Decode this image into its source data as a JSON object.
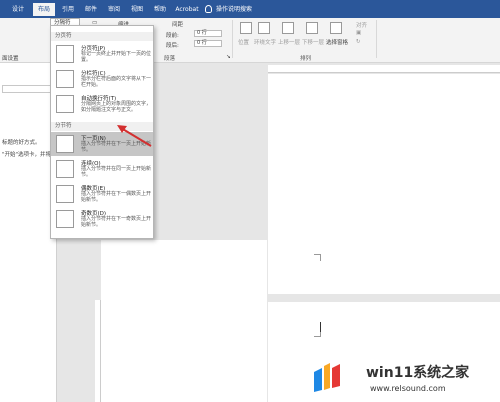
{
  "tabs": [
    {
      "label": "设计",
      "active": false
    },
    {
      "label": "布局",
      "active": true
    },
    {
      "label": "引用",
      "active": false
    },
    {
      "label": "邮件",
      "active": false
    },
    {
      "label": "审阅",
      "active": false
    },
    {
      "label": "视图",
      "active": false
    },
    {
      "label": "帮助",
      "active": false
    },
    {
      "label": "Acrobat",
      "active": false
    }
  ],
  "tell_me": "操作说明搜索",
  "ribbon": {
    "breaks_btn": "分隔符",
    "indent_label": "缩进",
    "spacing_label": "间距",
    "spacing_before": "段前:",
    "spacing_after": "段后:",
    "spacing_before_val": "0 行",
    "spacing_after_val": "0 行",
    "paragraph_group": "段落",
    "page_setup_group": "页面设置",
    "position_btn": "位置",
    "wrap_btn": "环绕文字",
    "forward_btn": "上移一层",
    "backward_btn": "下移一层",
    "selection_pane_btn": "选择窗格",
    "align_btn": "对齐",
    "arrange_group": "排列"
  },
  "leftpane": {
    "line1": "面设置",
    "line2": "标题的好方式。",
    "line3": "\"开始\"选项卡，并将文档中"
  },
  "dropdown": {
    "trigger_label": "分隔符",
    "section_page": "分页符",
    "section_section": "分节符",
    "items": [
      {
        "title": "分页符(P)",
        "desc": "标记一页终止并开始下一页的位置。"
      },
      {
        "title": "分栏符(C)",
        "desc": "指示分栏符后面的文字将从下一栏开始。"
      },
      {
        "title": "自动换行符(T)",
        "desc": "分隔网页上的对象周围的文字，如分隔题注文字与正文。"
      },
      {
        "title": "下一页(N)",
        "desc": "插入分节符并在下一页上开始新节。"
      },
      {
        "title": "连续(O)",
        "desc": "插入分节符并在同一页上开始新节。"
      },
      {
        "title": "偶数页(E)",
        "desc": "插入分节符并在下一偶数页上开始新节。"
      },
      {
        "title": "奇数页(D)",
        "desc": "插入分节符并在下一奇数页上开始新节。"
      }
    ]
  },
  "watermark": {
    "name": "win11系统之家",
    "url": "www.relsound.com"
  },
  "colors": {
    "tab_bar": "#2b579a",
    "hover": "#c6c6c6",
    "arrow": "#d32f2f"
  }
}
